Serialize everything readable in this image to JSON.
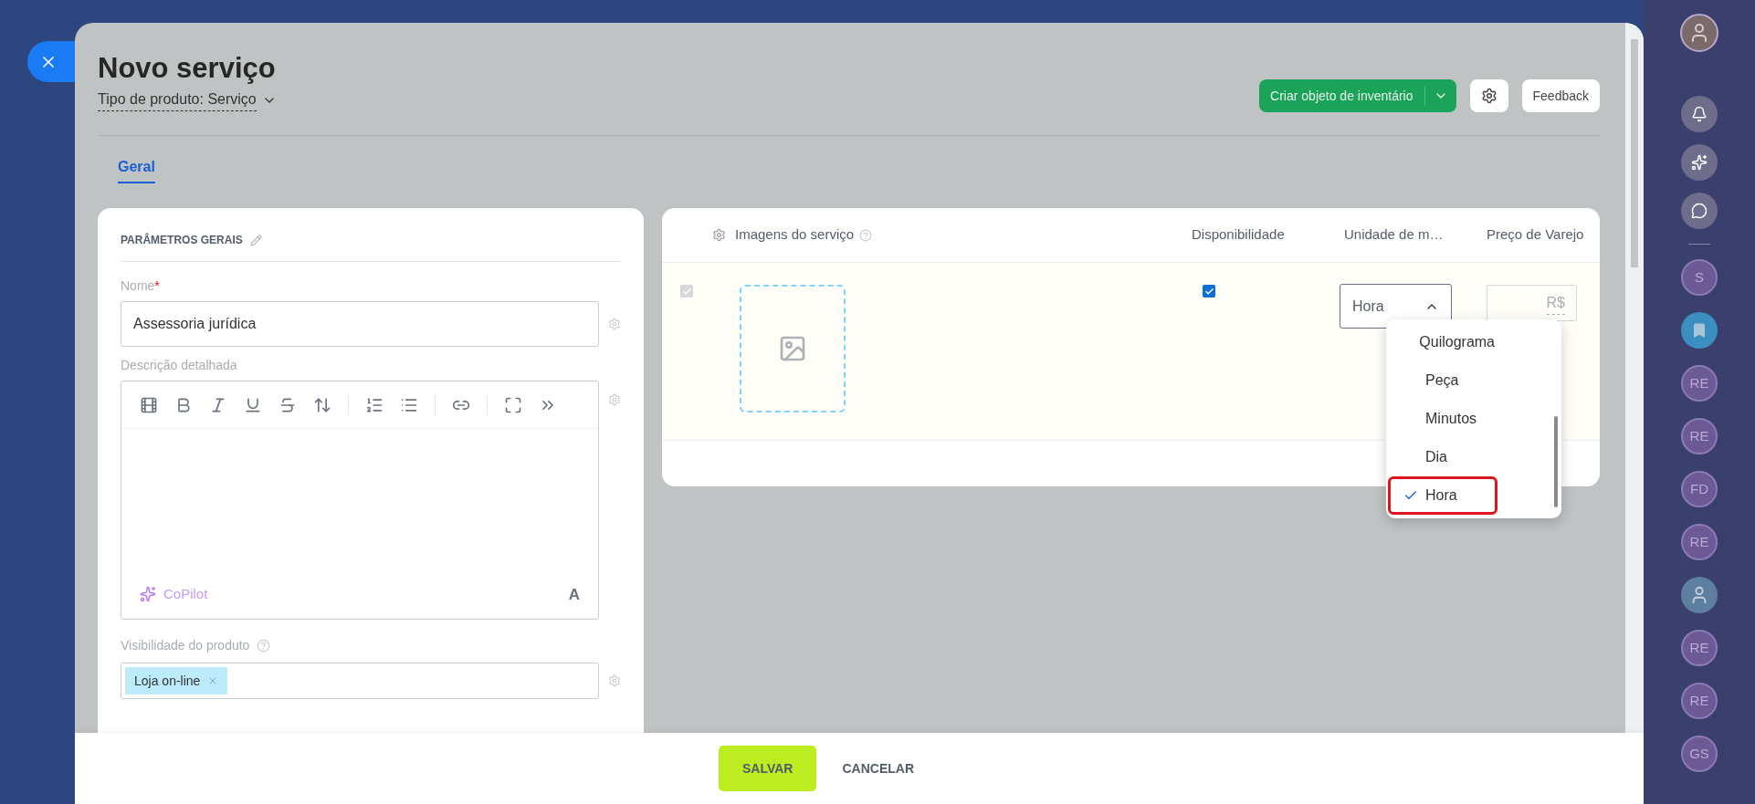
{
  "header": {
    "title": "Novo serviço",
    "subtitle": "Tipo de produto: Serviço",
    "primary_action": "Criar objeto de inventário",
    "feedback": "Feedback"
  },
  "tabs": [
    {
      "label": "Geral",
      "selected": true
    }
  ],
  "general_params": {
    "title": "PARÂMETROS GERAIS",
    "name_label": "Nome",
    "name_required_mark": "*",
    "name_value": "Assessoria jurídica",
    "description_label": "Descrição detalhada",
    "copilot": "CoPilot",
    "text_format_glyph": "A",
    "visibility_label": "Visibilidade do produto",
    "visibility_tags": [
      "Loja on-line"
    ]
  },
  "variants_table": {
    "columns": [
      "Imagens do serviço",
      "Disponibilidade",
      "Unidade de m…",
      "Preço de Varejo"
    ],
    "row": {
      "checked": true,
      "disabled": true,
      "available": true,
      "unit": "Hora",
      "currency": "R$"
    }
  },
  "unit_dropdown": {
    "expanded": true,
    "options": [
      {
        "label": "Quilograma",
        "selected": false,
        "highlighted": false
      },
      {
        "label": "Peça",
        "selected": false,
        "highlighted": false
      },
      {
        "label": "Minutos",
        "selected": false,
        "highlighted": false
      },
      {
        "label": "Dia",
        "selected": false,
        "highlighted": false
      },
      {
        "label": "Hora",
        "selected": true,
        "highlighted": true
      }
    ]
  },
  "footer": {
    "buttons": [
      {
        "label": "SALVAR",
        "kind": "primary"
      },
      {
        "label": "CANCELAR",
        "kind": "link"
      }
    ]
  },
  "sidebar": {
    "items": [
      {
        "kind": "initials",
        "label": "S"
      },
      {
        "kind": "bookmark"
      },
      {
        "kind": "initials",
        "label": "RE"
      },
      {
        "kind": "initials",
        "label": "RE"
      },
      {
        "kind": "initials",
        "label": "FD"
      },
      {
        "kind": "initials",
        "label": "RE"
      },
      {
        "kind": "picture"
      },
      {
        "kind": "initials",
        "label": "RE"
      },
      {
        "kind": "initials",
        "label": "RE"
      },
      {
        "kind": "initials",
        "label": "GS"
      }
    ]
  }
}
